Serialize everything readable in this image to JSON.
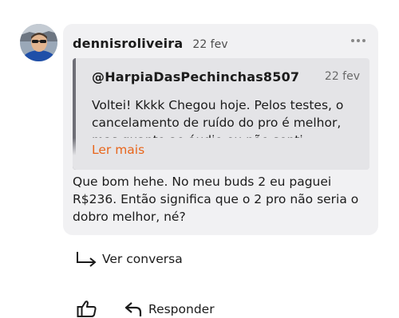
{
  "comment": {
    "username": "dennisroliveira",
    "date": "22 fev",
    "body": "Que bom hehe. No meu buds 2 eu paguei R$236. Então significa que o 2 pro não seria o dobro melhor, né?",
    "more_icon": "more-horizontal-icon"
  },
  "quote": {
    "username": "@HarpiaDasPechinchas8507",
    "date": "22 fev",
    "text": "Voltei! Kkkk Chegou hoje. Pelos testes, o cancelamento de ruído do pro é melhor, mas quanto ao áudio eu não senti",
    "read_more": "Ler mais"
  },
  "actions": {
    "view_conversation": "Ver conversa",
    "reply": "Responder",
    "like_icon": "thumbs-up-icon",
    "reply_icon": "reply-arrow-icon",
    "view_icon": "arrow-down-right-icon"
  },
  "colors": {
    "card_bg": "#f1f1f3",
    "quote_bg": "#e4e4e7",
    "accent": "#e8661c"
  }
}
